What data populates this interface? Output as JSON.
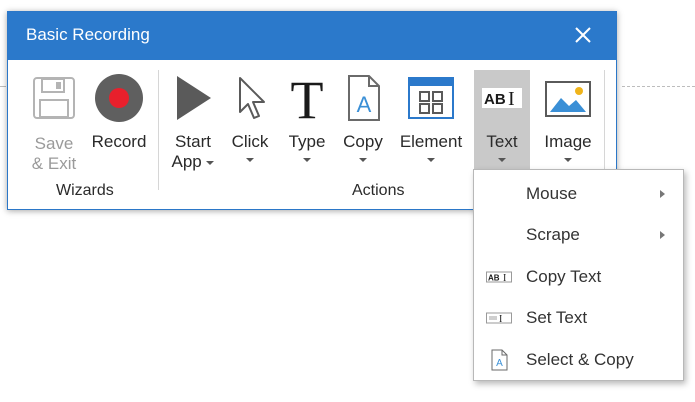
{
  "window": {
    "title": "Basic Recording",
    "close_icon": "close-icon"
  },
  "ribbon": {
    "save_exit": {
      "line1": "Save",
      "line2": "& Exit",
      "icon": "floppy-disk-icon",
      "enabled": false
    },
    "record": {
      "label": "Record",
      "icon": "record-icon",
      "color": "#e8202c"
    },
    "start_app": {
      "line1": "Start",
      "line2": "App",
      "icon": "play-icon"
    },
    "click": {
      "label": "Click",
      "icon": "cursor-arrow-icon"
    },
    "type": {
      "label": "Type",
      "icon": "type-t-icon"
    },
    "copy": {
      "label": "Copy",
      "icon": "copy-document-icon"
    },
    "element": {
      "label": "Element",
      "icon": "element-window-icon"
    },
    "text": {
      "label": "Text",
      "icon": "text-abi-icon",
      "active": true
    },
    "image": {
      "label": "Image",
      "icon": "image-icon"
    },
    "groups": {
      "wizards": "Wizards",
      "actions": "Actions"
    }
  },
  "menu": {
    "items": [
      {
        "label": "Mouse",
        "has_submenu": true,
        "icon": ""
      },
      {
        "label": "Scrape",
        "has_submenu": true,
        "icon": ""
      },
      {
        "label": "Copy Text",
        "has_submenu": false,
        "icon": "copy-text-icon"
      },
      {
        "label": "Set Text",
        "has_submenu": false,
        "icon": "set-text-icon"
      },
      {
        "label": "Select & Copy",
        "has_submenu": false,
        "icon": "select-copy-icon"
      }
    ]
  },
  "colors": {
    "titlebar": "#2b79cb",
    "accent": "#2b79cb",
    "record_red": "#e8202c",
    "active_button": "#c9c9c9"
  }
}
